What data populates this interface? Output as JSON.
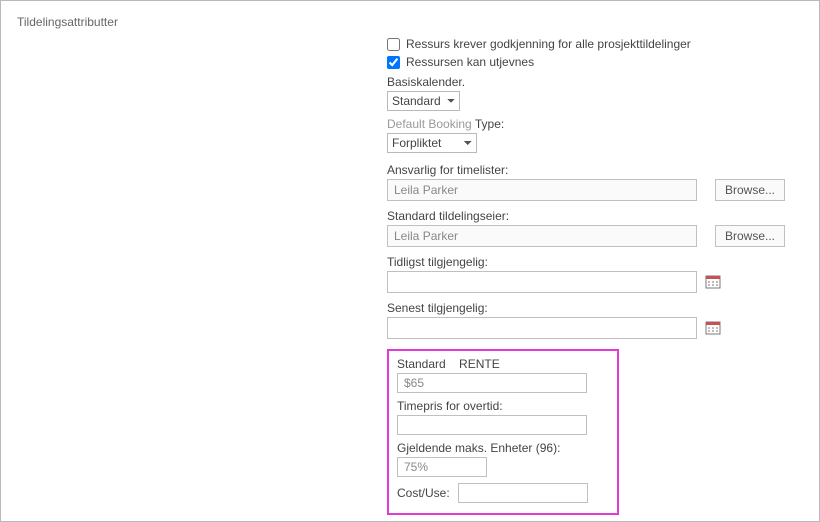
{
  "section_title": "Tildelingsattributter",
  "checkboxes": {
    "approval": {
      "label": "Ressurs krever godkjenning for alle prosjekttildelinger",
      "checked": false
    },
    "leveling": {
      "label": "Ressursen kan utjevnes",
      "checked": true
    }
  },
  "basis_calendar": {
    "label": "Basiskalender.",
    "value": "Standard",
    "options": [
      "Standard"
    ]
  },
  "default_booking": {
    "label_dim": "Default Booking",
    "label_rest": "Type:",
    "value": "Forpliktet",
    "options": [
      "Forpliktet"
    ]
  },
  "timesheet_approver": {
    "label": "Ansvarlig for timelister:",
    "value": "Leila Parker",
    "browse": "Browse..."
  },
  "assignment_owner": {
    "label": "Standard tildelingseier:",
    "value": "Leila Parker",
    "browse": "Browse..."
  },
  "earliest": {
    "label": "Tidligst tilgjengelig:",
    "value": ""
  },
  "latest": {
    "label": "Senest tilgjengelig:",
    "value": ""
  },
  "rates": {
    "standard_rate_label": "Standard    RENTE",
    "standard_rate_value": "$65",
    "overtime_label": "Timepris for overtid:",
    "overtime_value": "",
    "max_units_label": "Gjeldende maks. Enheter (96):",
    "max_units_value": "75%",
    "cost_use_label": "Cost/Use:",
    "cost_use_value": ""
  }
}
